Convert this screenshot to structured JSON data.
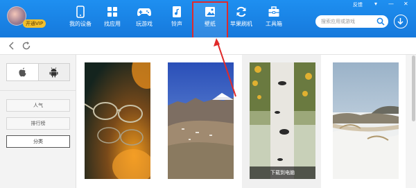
{
  "header": {
    "vip_label": "开通VIP",
    "feedback": "反馈",
    "window_controls": [
      "▾",
      "—",
      "✕"
    ],
    "nav": [
      {
        "label": "我的设备",
        "icon": "phone-icon"
      },
      {
        "label": "找应用",
        "icon": "apps-icon"
      },
      {
        "label": "玩游戏",
        "icon": "gamepad-icon"
      },
      {
        "label": "铃声",
        "icon": "music-icon"
      },
      {
        "label": "壁纸",
        "icon": "image-icon",
        "selected": true
      },
      {
        "label": "苹果刷机",
        "icon": "refresh-icon"
      },
      {
        "label": "工具箱",
        "icon": "toolbox-icon"
      }
    ],
    "search_placeholder": "搜索应用或游戏"
  },
  "sidebar": {
    "os_options": [
      "apple-icon",
      "android-icon"
    ],
    "selected_os": "android",
    "categories": [
      "人气",
      "排行榜",
      "分类"
    ],
    "active_category": "分类"
  },
  "wallpapers": {
    "items": [
      {
        "icon": "glasses-wallpaper"
      },
      {
        "icon": "mountain-wallpaper"
      },
      {
        "icon": "birch-tree-wallpaper",
        "hover_label": "下载到电脑"
      },
      {
        "icon": "snow-dunes-wallpaper"
      }
    ]
  },
  "colors": {
    "header_blue": "#1a84e8",
    "highlight_red": "#e02a2a"
  }
}
